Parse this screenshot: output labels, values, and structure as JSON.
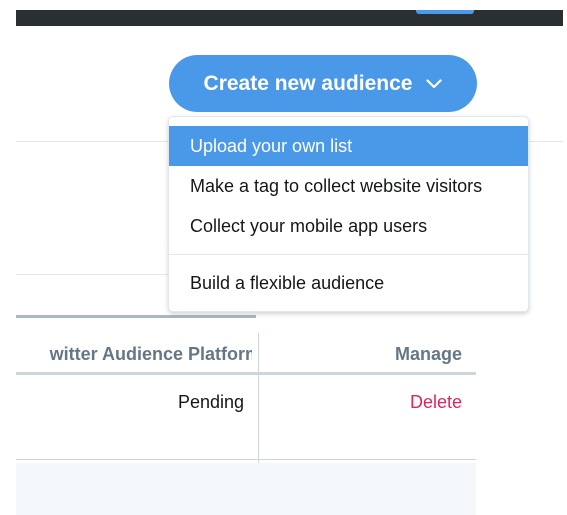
{
  "header": {
    "create_button_label": "Create new audience"
  },
  "menu": {
    "items": [
      {
        "label": "Upload your own list"
      },
      {
        "label": "Make a tag to collect website visitors"
      },
      {
        "label": "Collect your mobile app users"
      },
      {
        "label": "Build a flexible audience"
      }
    ]
  },
  "table": {
    "columns": [
      "witter Audience Platform",
      "Manage"
    ],
    "rows": [
      {
        "status": "Pending",
        "action": "Delete"
      }
    ]
  },
  "colors": {
    "accent": "#4a99e9",
    "danger": "#e0245e",
    "nav_dark": "#292f33"
  },
  "icons": {
    "cta_chevron": "chevron-down-icon"
  }
}
